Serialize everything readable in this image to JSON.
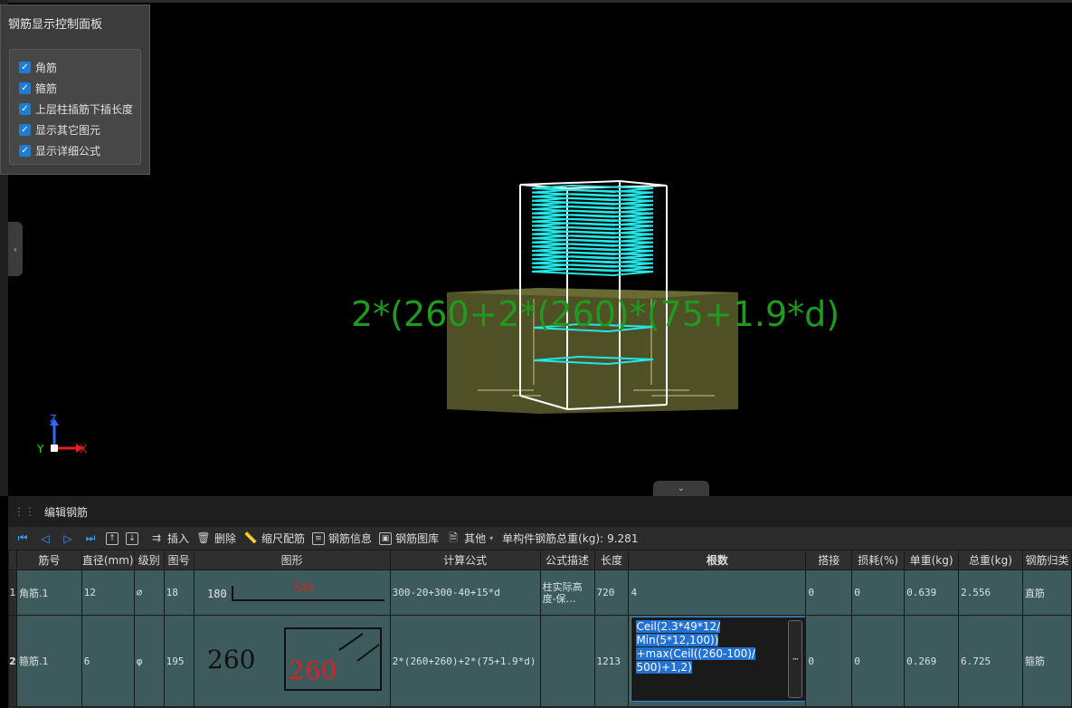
{
  "control_panel": {
    "title": "钢筋显示控制面板",
    "options": [
      {
        "label": "角筋",
        "checked": true
      },
      {
        "label": "箍筋",
        "checked": true
      },
      {
        "label": "上层柱插筋下插长度",
        "checked": true
      },
      {
        "label": "显示其它图元",
        "checked": true
      },
      {
        "label": "显示详细公式",
        "checked": true
      }
    ]
  },
  "viewport": {
    "formula_overlay": "2*(260+2*(260)*(75+1.9*d)",
    "axis": {
      "z": "Z",
      "x": "X",
      "y": "Y"
    },
    "colors": {
      "stirrup": "#25e6e6",
      "frame": "#ffffff",
      "concrete": "#6b6b34",
      "formula": "#1f9a1f"
    }
  },
  "editor": {
    "title": "编辑钢筋",
    "toolbar": {
      "insert": "插入",
      "delete": "删除",
      "scale": "缩尺配筋",
      "info": "钢筋信息",
      "library": "钢筋图库",
      "other": "其他",
      "total_label": "单构件钢筋总重(kg):",
      "total_value": "9.281"
    },
    "columns": [
      "筋号",
      "直径(mm)",
      "级别",
      "图号",
      "图形",
      "计算公式",
      "公式描述",
      "长度",
      "根数",
      "搭接",
      "损耗(%)",
      "单重(kg)",
      "总重(kg)",
      "钢筋归类"
    ],
    "rows": [
      {
        "num": "1",
        "name": "角筋.1",
        "diameter": "12",
        "grade": "⌀",
        "fig": "18",
        "shape_left": "180",
        "shape_right": "540",
        "formula": "300-20+300-40+15*d",
        "desc": "柱实际高度-保…",
        "length": "720",
        "count": "4",
        "lap": "0",
        "loss": "0",
        "unit_weight": "0.639",
        "total_weight": "2.556",
        "category": "直筋"
      },
      {
        "num": "2",
        "name": "箍筋.1",
        "diameter": "6",
        "grade": "φ",
        "fig": "195",
        "shape_left": "260",
        "shape_right": "260",
        "formula": "2*(260+260)+2*(75+1.9*d)",
        "desc": "",
        "length": "1213",
        "count": "Ceil(2.3*49*12/\nMin(5*12,100))\n+max(Ceil((260-100)/\n500)+1,2)",
        "lap": "0",
        "loss": "0",
        "unit_weight": "0.269",
        "total_weight": "6.725",
        "category": "箍筋"
      }
    ]
  }
}
